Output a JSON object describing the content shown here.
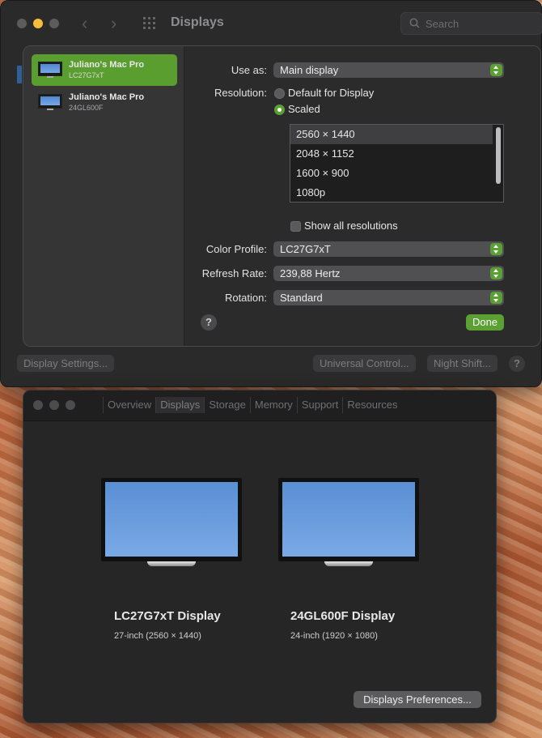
{
  "colors": {
    "accent_green": "#5aa032",
    "window_bg": "#2a2a2b",
    "screen_blue": "#6a9fe0"
  },
  "prefs_window": {
    "title": "Displays",
    "search_placeholder": "Search",
    "bottom": {
      "display_settings": "Display Settings...",
      "universal_control": "Universal Control...",
      "night_shift": "Night Shift...",
      "help": "?"
    }
  },
  "sheet": {
    "displays": [
      {
        "name": "Juliano's Mac Pro",
        "model": "LC27G7xT",
        "selected": true
      },
      {
        "name": "Juliano's Mac Pro",
        "model": "24GL600F",
        "selected": false
      }
    ],
    "use_as_label": "Use as:",
    "use_as_value": "Main display",
    "resolution_label": "Resolution:",
    "res_default": "Default for Display",
    "res_scaled": "Scaled",
    "resolutions": [
      "2560 × 1440",
      "2048 × 1152",
      "1600 × 900",
      "1080p"
    ],
    "selected_resolution": "2560 × 1440",
    "show_all_label": "Show all resolutions",
    "color_profile_label": "Color Profile:",
    "color_profile_value": "LC27G7xT",
    "refresh_rate_label": "Refresh Rate:",
    "refresh_rate_value": "239,88 Hertz",
    "rotation_label": "Rotation:",
    "rotation_value": "Standard",
    "help": "?",
    "done": "Done"
  },
  "about_window": {
    "tabs": [
      "Overview",
      "Displays",
      "Storage",
      "Memory",
      "Support",
      "Resources"
    ],
    "active_tab": "Displays",
    "monitors": [
      {
        "title": "LC27G7xT Display",
        "spec": "27-inch (2560 × 1440)"
      },
      {
        "title": "24GL600F Display",
        "spec": "24-inch (1920 × 1080)"
      }
    ],
    "prefs_button": "Displays Preferences..."
  }
}
